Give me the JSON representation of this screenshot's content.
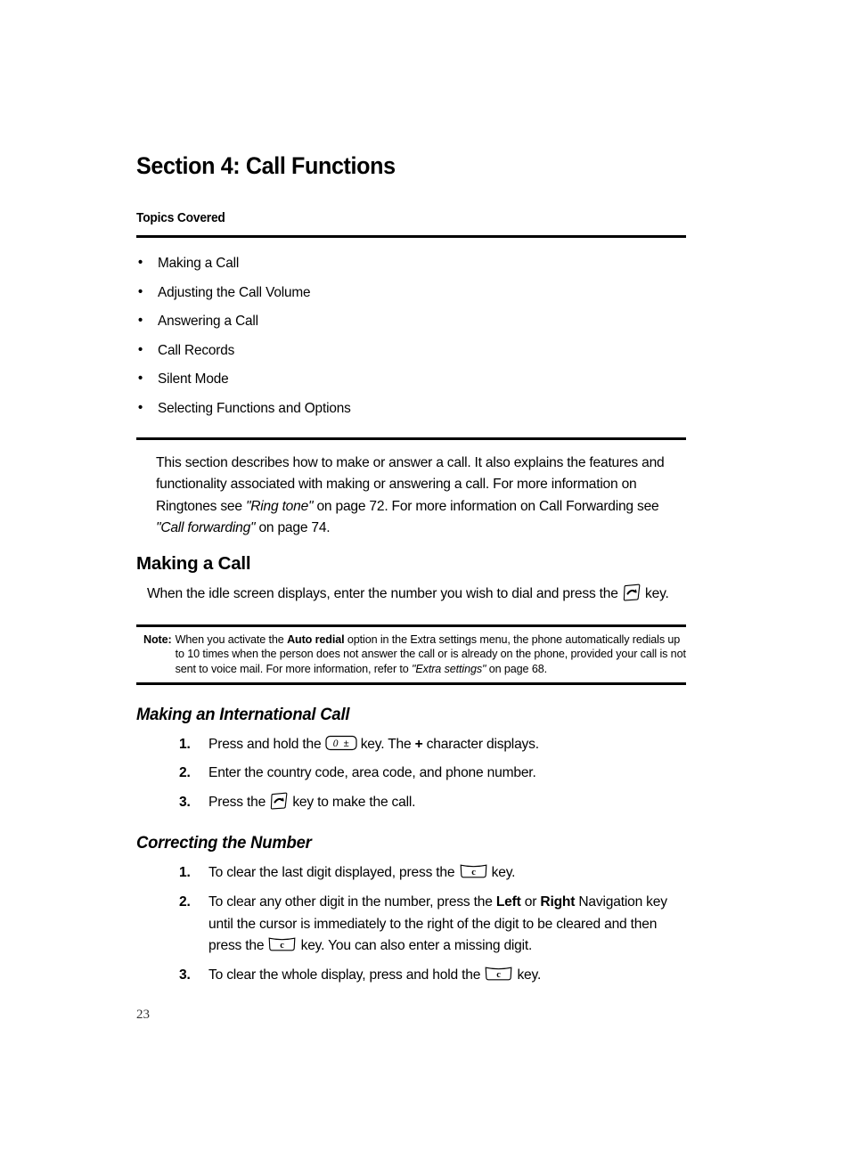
{
  "document": {
    "section_title": "Section 4: Call Functions",
    "topics_label": "Topics Covered",
    "page_number": "23"
  },
  "topics": [
    {
      "label": "Making a Call"
    },
    {
      "label": "Adjusting the Call Volume"
    },
    {
      "label": "Answering a Call"
    },
    {
      "label": "Call Records"
    },
    {
      "label": "Silent Mode"
    },
    {
      "label": "Selecting Functions and Options"
    }
  ],
  "intro": {
    "part1": "This section describes how to make or answer a call. It also explains the features and functionality associated with making or answering a call. For more information on Ringtones see ",
    "ref1": "\"Ring tone\"",
    "part2": " on page 72. For more information on Call Forwarding see ",
    "ref2": "\"Call forwarding\"",
    "part3": " on page 74."
  },
  "making_a_call": {
    "heading": "Making a Call",
    "body_before_key": "When the idle screen displays, enter the number you wish to dial and press the ",
    "body_after_key": " key."
  },
  "note": {
    "label": "Note:",
    "text_part1": "When you activate the ",
    "bold_term": "Auto redial",
    "text_part2": " option in the Extra settings menu, the phone automatically redials up to 10 times when the person does not answer the call or is already on the phone, provided your call is not sent to voice mail. For more information, refer to ",
    "ref": "\"Extra settings\"",
    "text_part3": " on page 68."
  },
  "international": {
    "heading": "Making an International Call",
    "steps": [
      {
        "num": "1.",
        "before_key": "Press and hold the ",
        "key": "zero-plusminus-key",
        "after_key": " key. The ",
        "bold": "+",
        "tail": " character displays."
      },
      {
        "num": "2.",
        "before_key": "Enter the country code, area code, and phone number.",
        "key": "",
        "after_key": "",
        "bold": "",
        "tail": ""
      },
      {
        "num": "3.",
        "before_key": "Press the ",
        "key": "send-key",
        "after_key": " key to make the call.",
        "bold": "",
        "tail": ""
      }
    ]
  },
  "correcting": {
    "heading": "Correcting the Number",
    "steps": [
      {
        "num": "1.",
        "seg1": "To clear the last digit displayed, press the ",
        "seg2": " key."
      },
      {
        "num": "2.",
        "seg1": "To clear any other digit in the number, press the ",
        "bold1": "Left",
        "seg_mid": " or ",
        "bold2": "Right",
        "seg2": " Navigation key until the cursor is immediately to the right of the digit to be cleared and then press the ",
        "seg3": " key. You can also enter a missing digit."
      },
      {
        "num": "3.",
        "seg1": "To clear the whole display, press and hold the ",
        "seg2": " key."
      }
    ]
  },
  "icons": {
    "send_key": "send-key-icon",
    "zero_key": "zero-plusminus-key-icon",
    "clear_key": "clear-key-icon",
    "bullet": "•"
  }
}
